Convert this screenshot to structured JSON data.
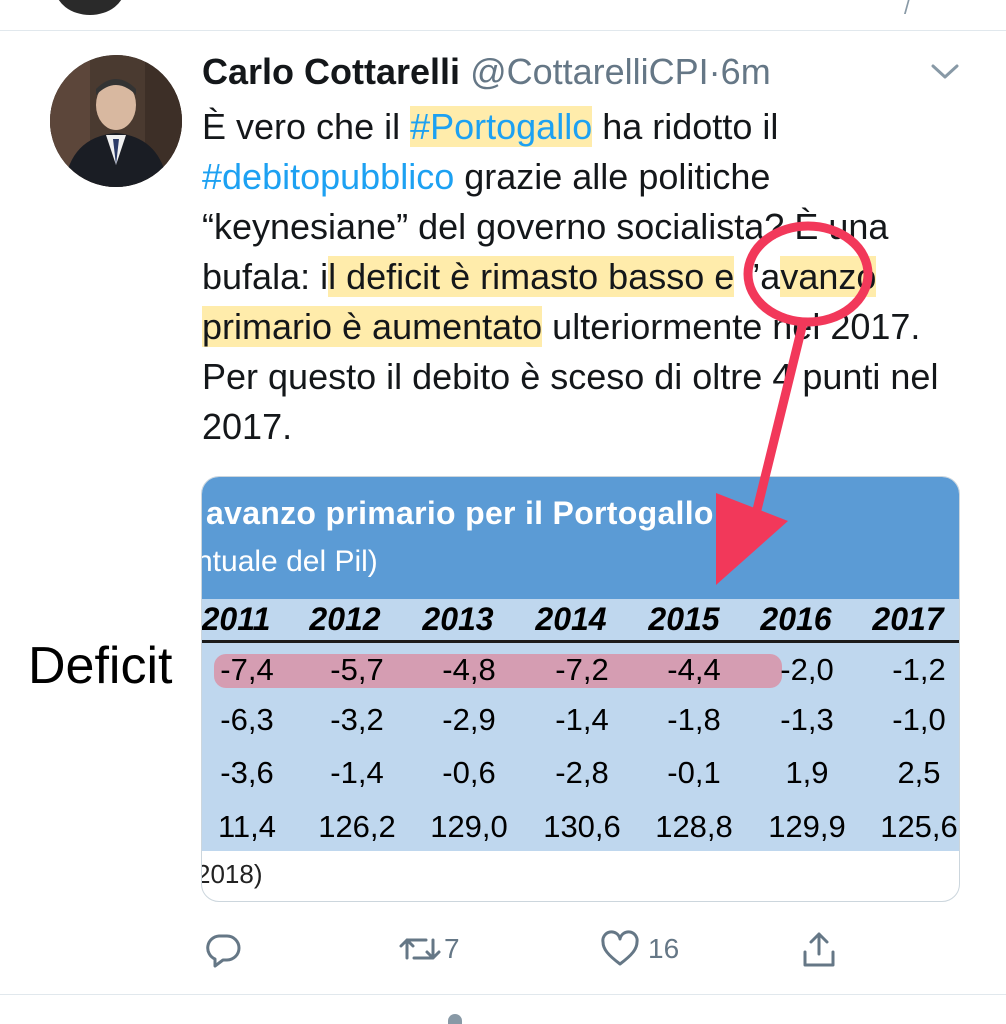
{
  "tweet": {
    "author_name": "Carlo Cottarelli",
    "handle": "@CottarelliCPI",
    "separator": "·",
    "time": "6m",
    "text_parts": [
      {
        "text": "È vero che il ",
        "style": "plain"
      },
      {
        "text": "#Portogallo",
        "style": "hashtag-highlight"
      },
      {
        "text": " ha ridotto il ",
        "style": "plain"
      },
      {
        "text": "#debitopubblico",
        "style": "hashtag"
      },
      {
        "text": " grazie alle politiche “keynesiane” del governo socialista? È una bufala: i",
        "style": "plain"
      },
      {
        "text": "l deficit è rimasto basso e",
        "style": "highlight"
      },
      {
        "text": " l’a",
        "style": "plain"
      },
      {
        "text": "vanzo primario è aumentato",
        "style": "highlight"
      },
      {
        "text": " ulteriormente nel 2017. Per questo il debito è sceso di oltre 4 punti nel 2017.",
        "style": "plain"
      }
    ]
  },
  "card": {
    "title": "avanzo primario per il Portogallo",
    "subtitle": "ntuale del Pil)",
    "footer": "2018)",
    "years": [
      "2011",
      "2012",
      "2013",
      "2014",
      "2015",
      "2016",
      "2017"
    ],
    "rows": [
      [
        "-7,4",
        "-5,7",
        "-4,8",
        "-7,2",
        "-4,4",
        "-2,0",
        "-1,2"
      ],
      [
        "-6,3",
        "-3,2",
        "-2,9",
        "-1,4",
        "-1,8",
        "-1,3",
        "-1,0"
      ],
      [
        "-3,6",
        "-1,4",
        "-0,6",
        "-2,8",
        "-0,1",
        "1,9",
        "2,5"
      ],
      [
        "11,4",
        "126,2",
        "129,0",
        "130,6",
        "128,8",
        "129,9",
        "125,6"
      ]
    ]
  },
  "annotations": {
    "deficit_label": "Deficit",
    "marker_color": "#f2385a",
    "highlight_color": "#ffdd66"
  },
  "actions": {
    "retweets": "7",
    "likes": "16"
  },
  "icons": [
    "chevron-down-icon",
    "reply-icon",
    "retweet-icon",
    "like-icon",
    "share-icon"
  ],
  "colors": {
    "hashtag": "#1da1f2",
    "secondary_text": "#657786",
    "card_header": "#5b9bd5",
    "card_table": "#bfd7ee"
  }
}
